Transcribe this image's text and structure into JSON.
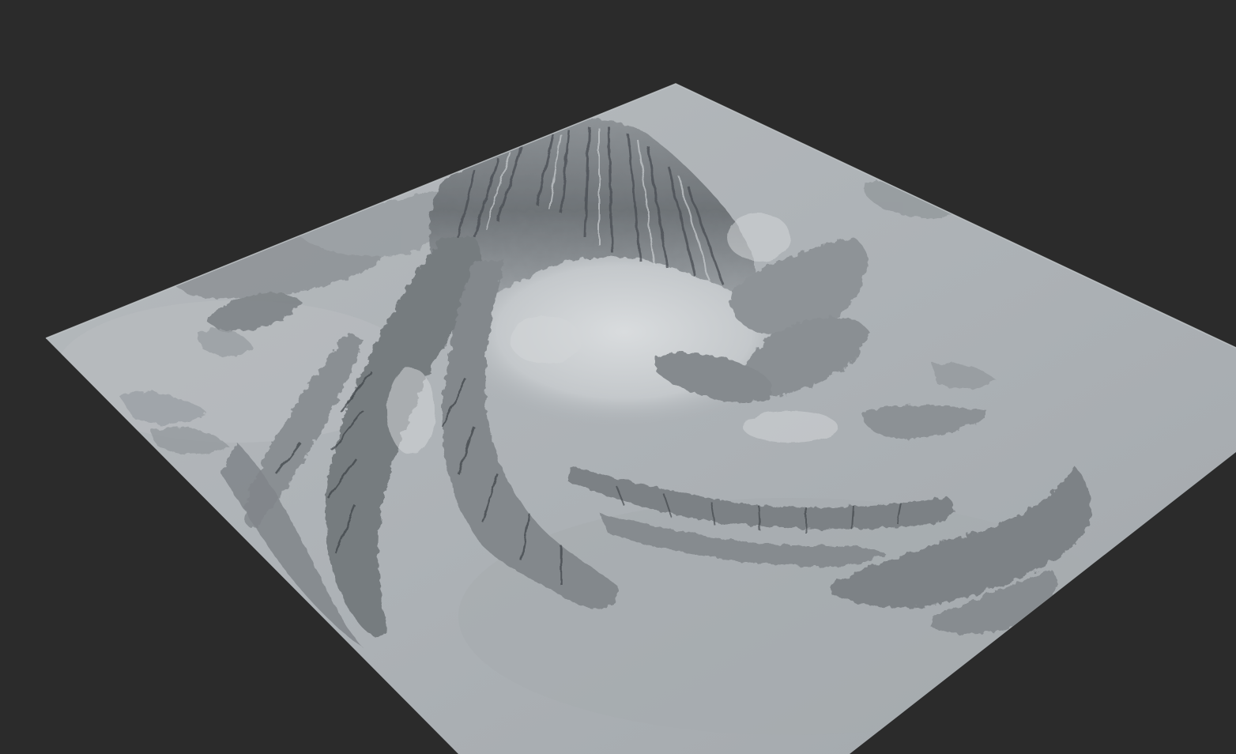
{
  "viewport": {
    "background_color": "#2b2b2b",
    "content": "terrain-render"
  },
  "terrain": {
    "material_color": "#aeb3b7",
    "shadow_color": "#3a3d40",
    "highlight_color": "#e6e8ea",
    "features": [
      "central-peak",
      "crater-bowl",
      "eroded-ridges",
      "flat-plain"
    ]
  }
}
